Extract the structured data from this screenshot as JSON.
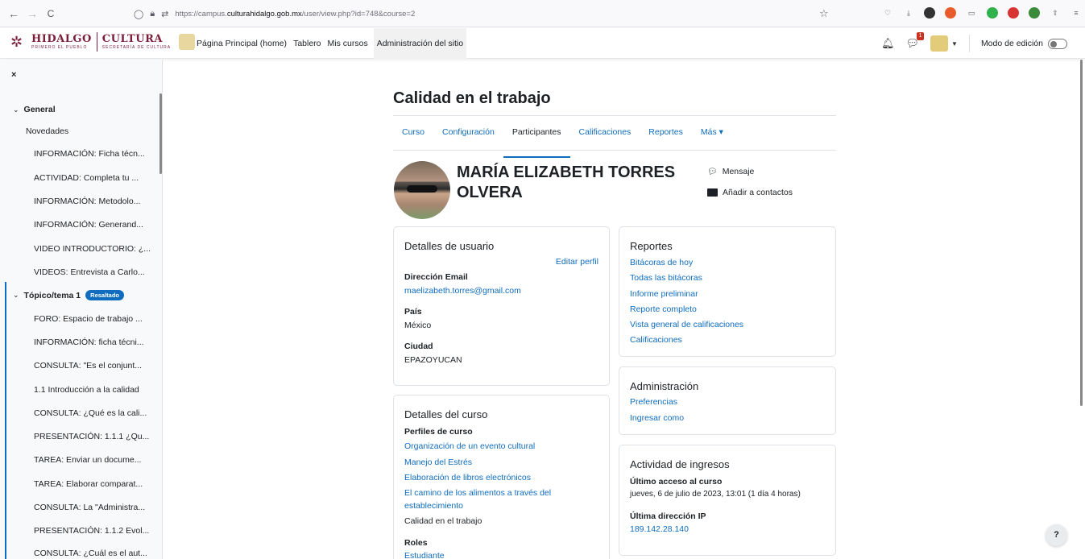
{
  "browser": {
    "back": "←",
    "forward": "→",
    "reload": "C",
    "url_prefix": "https://campus.",
    "url_domain": "culturahidalgo.gob.mx",
    "url_path": "/user/view.php?id=748&course=2"
  },
  "header": {
    "logo_hidalgo": "HIDALGO",
    "logo_hidalgo_sub": "PRIMERO EL PUEBLO",
    "logo_cultura": "CULTURA",
    "logo_cultura_sub": "SECRETARÍA DE CULTURA",
    "nav": [
      "Página Principal (home)",
      "Tablero",
      "Mis cursos",
      "Administración del sitio"
    ],
    "notification_count": "1",
    "edit_mode_label": "Modo de edición"
  },
  "drawer": {
    "close": "×",
    "general_label": "General",
    "topic_label": "Tópico/tema 1",
    "highlight_badge": "Resaltado",
    "general_items": [
      "Novedades",
      "INFORMACIÓN: Ficha técn...",
      "ACTIVIDAD: Completa tu ...",
      "INFORMACIÓN: Metodolo...",
      "INFORMACIÓN: Generand...",
      "VIDEO INTRODUCTORIO: ¿...",
      "VIDEOS: Entrevista a Carlo..."
    ],
    "topic_items": [
      "FORO: Espacio de trabajo ...",
      "INFORMACIÓN: ficha técni...",
      "CONSULTA: \"Es el conjunt...",
      "1.1 Introducción a la calidad",
      "CONSULTA: ¿Qué es la cali...",
      "PRESENTACIÓN: 1.1.1 ¿Qu...",
      "TAREA: Enviar un docume...",
      "TAREA: Elaborar comparat...",
      "CONSULTA: La \"Administra...",
      "PRESENTACIÓN: 1.1.2 Evol...",
      "CONSULTA: ¿Cuál es el aut..."
    ]
  },
  "main": {
    "course_title": "Calidad en el trabajo",
    "tabs": [
      "Curso",
      "Configuración",
      "Participantes",
      "Calificaciones",
      "Reportes",
      "Más ▾"
    ],
    "active_tab": "Participantes",
    "profile_name": "MARÍA ELIZABETH TORRES OLVERA",
    "message_label": "Mensaje",
    "add_contact_label": "Añadir a contactos"
  },
  "user_details": {
    "title": "Detalles de usuario",
    "edit_link": "Editar perfil",
    "email_label": "Dirección Email",
    "email_value": "maelizabeth.torres@gmail.com",
    "country_label": "País",
    "country_value": "México",
    "city_label": "Ciudad",
    "city_value": "EPAZOYUCAN"
  },
  "course_details": {
    "title": "Detalles del curso",
    "profiles_label": "Perfiles de curso",
    "profiles": [
      "Organización de un evento cultural",
      "Manejo del Estrés",
      "Elaboración de libros electrónicos",
      "El camino de los alimentos a través del",
      "establecimiento"
    ],
    "current_course": "Calidad en el trabajo",
    "roles_label": "Roles",
    "role_value": "Estudiante"
  },
  "reports": {
    "title": "Reportes",
    "links": [
      "Bitácoras de hoy",
      "Todas las bitácoras",
      "Informe preliminar",
      "Reporte completo",
      "Vista general de calificaciones",
      "Calificaciones"
    ]
  },
  "administration": {
    "title": "Administración",
    "links": [
      "Preferencias",
      "Ingresar como"
    ]
  },
  "login_activity": {
    "title": "Actividad de ingresos",
    "last_access_label": "Último acceso al curso",
    "last_access_value": "jueves, 6 de julio de 2023, 13:01  (1 día 4 horas)",
    "last_ip_label": "Última dirección IP",
    "last_ip_value": "189.142.28.140"
  },
  "help": "?"
}
